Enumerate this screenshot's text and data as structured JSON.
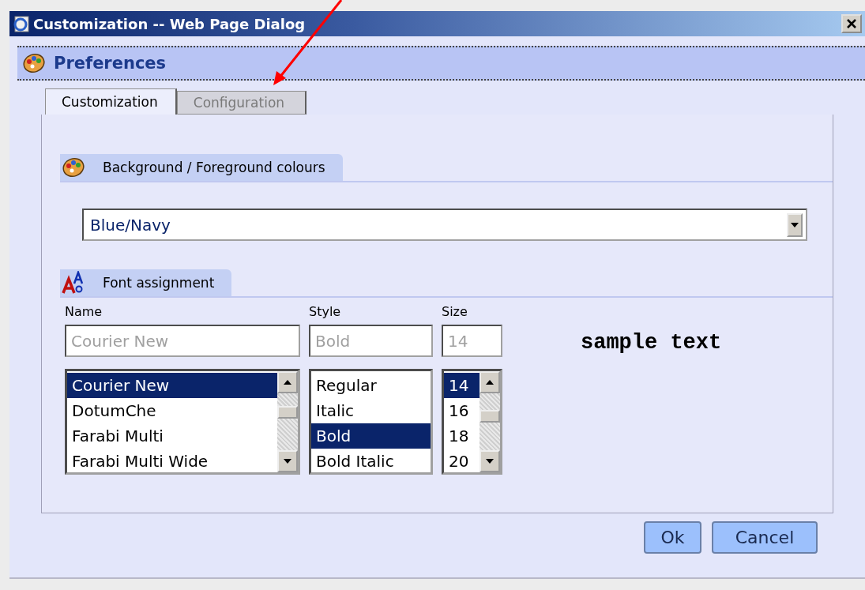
{
  "window": {
    "title": "Customization -- Web Page Dialog"
  },
  "header": {
    "title": "Preferences"
  },
  "tabs": [
    {
      "label": "Customization",
      "selected": true
    },
    {
      "label": "Configuration",
      "selected": false
    }
  ],
  "colours": {
    "title": "Background / Foreground colours",
    "select": {
      "value": "Blue/Navy"
    }
  },
  "font_assignment": {
    "title": "Font assignment",
    "sample": "sample text",
    "columns": [
      {
        "label": "Name",
        "value": "Courier New",
        "disabled": true,
        "options": [
          {
            "label": "Courier New",
            "selected": true
          },
          {
            "label": "DotumChe",
            "selected": false
          },
          {
            "label": "Farabi Multi",
            "selected": false
          },
          {
            "label": "Farabi Multi Wide",
            "selected": false
          }
        ]
      },
      {
        "label": "Style",
        "value": "Bold",
        "disabled": true,
        "options": [
          {
            "label": "Regular",
            "selected": false
          },
          {
            "label": "Italic",
            "selected": false
          },
          {
            "label": "Bold",
            "selected": true
          },
          {
            "label": "Bold Italic",
            "selected": false
          }
        ]
      },
      {
        "label": "Size",
        "value": "14",
        "disabled": true,
        "options": [
          {
            "label": "14",
            "selected": true
          },
          {
            "label": "16",
            "selected": false
          },
          {
            "label": "18",
            "selected": false
          },
          {
            "label": "20",
            "selected": false
          }
        ]
      }
    ]
  },
  "buttons": [
    "Ok",
    "Cancel"
  ]
}
